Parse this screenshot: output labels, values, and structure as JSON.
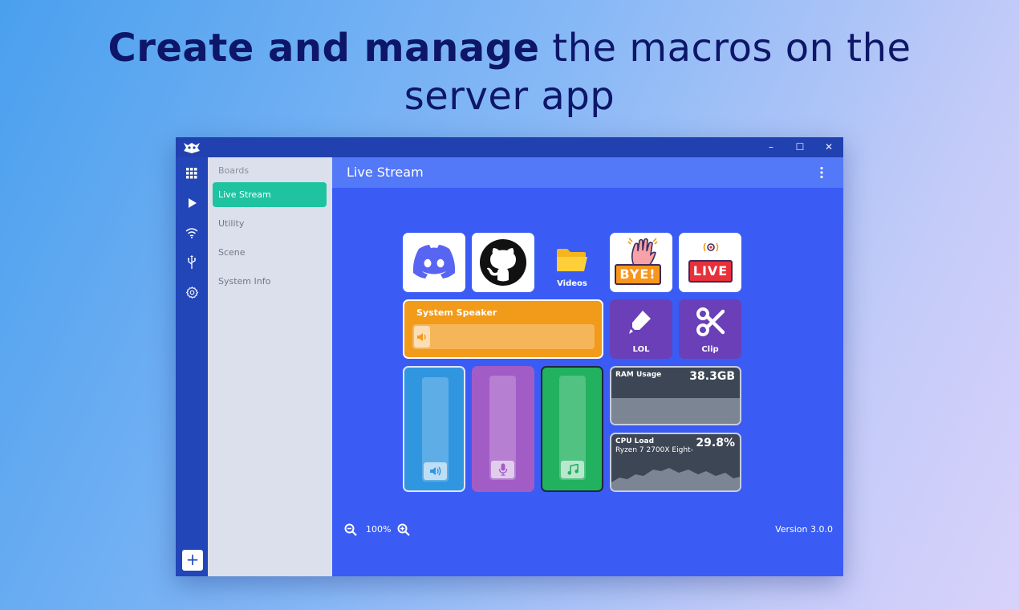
{
  "headline": {
    "bold": "Create and manage",
    "rest_line1": " the macros on the",
    "line2": "server app"
  },
  "window": {
    "controls": {
      "minimize": "–",
      "maximize": "☐",
      "close": "✕"
    }
  },
  "rail": {
    "add_label": "+"
  },
  "boards": {
    "title": "Boards",
    "items": [
      {
        "label": "Live Stream",
        "active": true
      },
      {
        "label": "Utility"
      },
      {
        "label": "Scene"
      },
      {
        "label": "System Info"
      }
    ]
  },
  "main": {
    "title": "Live Stream",
    "tiles": {
      "videos_label": "Videos",
      "bye_text": "BYE!",
      "live_text": "LIVE",
      "lol_label": "LOL",
      "clip_label": "Clip",
      "speaker_label": "System Speaker",
      "ram_label": "RAM Usage",
      "ram_value": "38.3GB",
      "cpu_label": "CPU Load",
      "cpu_sub": "Ryzen 7 2700X Eight-",
      "cpu_value": "29.8%"
    },
    "zoom": "100%",
    "version": "Version 3.0.0"
  },
  "colors": {
    "accent": "#1fc3a0",
    "main_bg": "#3a5cf4",
    "speaker": "#f29a1a",
    "purple": "#6a3fb8"
  }
}
